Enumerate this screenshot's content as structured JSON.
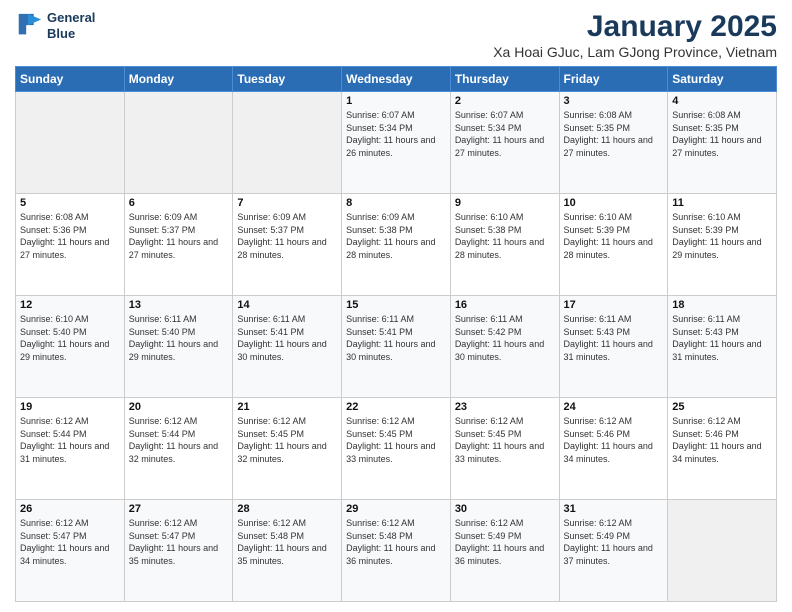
{
  "logo": {
    "line1": "General",
    "line2": "Blue"
  },
  "title": "January 2025",
  "subtitle": "Xa Hoai GJuc, Lam GJong Province, Vietnam",
  "days_of_week": [
    "Sunday",
    "Monday",
    "Tuesday",
    "Wednesday",
    "Thursday",
    "Friday",
    "Saturday"
  ],
  "weeks": [
    [
      {
        "day": "",
        "sunrise": "",
        "sunset": "",
        "daylight": "",
        "empty": true
      },
      {
        "day": "",
        "sunrise": "",
        "sunset": "",
        "daylight": "",
        "empty": true
      },
      {
        "day": "",
        "sunrise": "",
        "sunset": "",
        "daylight": "",
        "empty": true
      },
      {
        "day": "1",
        "sunrise": "Sunrise: 6:07 AM",
        "sunset": "Sunset: 5:34 PM",
        "daylight": "Daylight: 11 hours and 26 minutes."
      },
      {
        "day": "2",
        "sunrise": "Sunrise: 6:07 AM",
        "sunset": "Sunset: 5:34 PM",
        "daylight": "Daylight: 11 hours and 27 minutes."
      },
      {
        "day": "3",
        "sunrise": "Sunrise: 6:08 AM",
        "sunset": "Sunset: 5:35 PM",
        "daylight": "Daylight: 11 hours and 27 minutes."
      },
      {
        "day": "4",
        "sunrise": "Sunrise: 6:08 AM",
        "sunset": "Sunset: 5:35 PM",
        "daylight": "Daylight: 11 hours and 27 minutes."
      }
    ],
    [
      {
        "day": "5",
        "sunrise": "Sunrise: 6:08 AM",
        "sunset": "Sunset: 5:36 PM",
        "daylight": "Daylight: 11 hours and 27 minutes."
      },
      {
        "day": "6",
        "sunrise": "Sunrise: 6:09 AM",
        "sunset": "Sunset: 5:37 PM",
        "daylight": "Daylight: 11 hours and 27 minutes."
      },
      {
        "day": "7",
        "sunrise": "Sunrise: 6:09 AM",
        "sunset": "Sunset: 5:37 PM",
        "daylight": "Daylight: 11 hours and 28 minutes."
      },
      {
        "day": "8",
        "sunrise": "Sunrise: 6:09 AM",
        "sunset": "Sunset: 5:38 PM",
        "daylight": "Daylight: 11 hours and 28 minutes."
      },
      {
        "day": "9",
        "sunrise": "Sunrise: 6:10 AM",
        "sunset": "Sunset: 5:38 PM",
        "daylight": "Daylight: 11 hours and 28 minutes."
      },
      {
        "day": "10",
        "sunrise": "Sunrise: 6:10 AM",
        "sunset": "Sunset: 5:39 PM",
        "daylight": "Daylight: 11 hours and 28 minutes."
      },
      {
        "day": "11",
        "sunrise": "Sunrise: 6:10 AM",
        "sunset": "Sunset: 5:39 PM",
        "daylight": "Daylight: 11 hours and 29 minutes."
      }
    ],
    [
      {
        "day": "12",
        "sunrise": "Sunrise: 6:10 AM",
        "sunset": "Sunset: 5:40 PM",
        "daylight": "Daylight: 11 hours and 29 minutes."
      },
      {
        "day": "13",
        "sunrise": "Sunrise: 6:11 AM",
        "sunset": "Sunset: 5:40 PM",
        "daylight": "Daylight: 11 hours and 29 minutes."
      },
      {
        "day": "14",
        "sunrise": "Sunrise: 6:11 AM",
        "sunset": "Sunset: 5:41 PM",
        "daylight": "Daylight: 11 hours and 30 minutes."
      },
      {
        "day": "15",
        "sunrise": "Sunrise: 6:11 AM",
        "sunset": "Sunset: 5:41 PM",
        "daylight": "Daylight: 11 hours and 30 minutes."
      },
      {
        "day": "16",
        "sunrise": "Sunrise: 6:11 AM",
        "sunset": "Sunset: 5:42 PM",
        "daylight": "Daylight: 11 hours and 30 minutes."
      },
      {
        "day": "17",
        "sunrise": "Sunrise: 6:11 AM",
        "sunset": "Sunset: 5:43 PM",
        "daylight": "Daylight: 11 hours and 31 minutes."
      },
      {
        "day": "18",
        "sunrise": "Sunrise: 6:11 AM",
        "sunset": "Sunset: 5:43 PM",
        "daylight": "Daylight: 11 hours and 31 minutes."
      }
    ],
    [
      {
        "day": "19",
        "sunrise": "Sunrise: 6:12 AM",
        "sunset": "Sunset: 5:44 PM",
        "daylight": "Daylight: 11 hours and 31 minutes."
      },
      {
        "day": "20",
        "sunrise": "Sunrise: 6:12 AM",
        "sunset": "Sunset: 5:44 PM",
        "daylight": "Daylight: 11 hours and 32 minutes."
      },
      {
        "day": "21",
        "sunrise": "Sunrise: 6:12 AM",
        "sunset": "Sunset: 5:45 PM",
        "daylight": "Daylight: 11 hours and 32 minutes."
      },
      {
        "day": "22",
        "sunrise": "Sunrise: 6:12 AM",
        "sunset": "Sunset: 5:45 PM",
        "daylight": "Daylight: 11 hours and 33 minutes."
      },
      {
        "day": "23",
        "sunrise": "Sunrise: 6:12 AM",
        "sunset": "Sunset: 5:45 PM",
        "daylight": "Daylight: 11 hours and 33 minutes."
      },
      {
        "day": "24",
        "sunrise": "Sunrise: 6:12 AM",
        "sunset": "Sunset: 5:46 PM",
        "daylight": "Daylight: 11 hours and 34 minutes."
      },
      {
        "day": "25",
        "sunrise": "Sunrise: 6:12 AM",
        "sunset": "Sunset: 5:46 PM",
        "daylight": "Daylight: 11 hours and 34 minutes."
      }
    ],
    [
      {
        "day": "26",
        "sunrise": "Sunrise: 6:12 AM",
        "sunset": "Sunset: 5:47 PM",
        "daylight": "Daylight: 11 hours and 34 minutes."
      },
      {
        "day": "27",
        "sunrise": "Sunrise: 6:12 AM",
        "sunset": "Sunset: 5:47 PM",
        "daylight": "Daylight: 11 hours and 35 minutes."
      },
      {
        "day": "28",
        "sunrise": "Sunrise: 6:12 AM",
        "sunset": "Sunset: 5:48 PM",
        "daylight": "Daylight: 11 hours and 35 minutes."
      },
      {
        "day": "29",
        "sunrise": "Sunrise: 6:12 AM",
        "sunset": "Sunset: 5:48 PM",
        "daylight": "Daylight: 11 hours and 36 minutes."
      },
      {
        "day": "30",
        "sunrise": "Sunrise: 6:12 AM",
        "sunset": "Sunset: 5:49 PM",
        "daylight": "Daylight: 11 hours and 36 minutes."
      },
      {
        "day": "31",
        "sunrise": "Sunrise: 6:12 AM",
        "sunset": "Sunset: 5:49 PM",
        "daylight": "Daylight: 11 hours and 37 minutes."
      },
      {
        "day": "",
        "sunrise": "",
        "sunset": "",
        "daylight": "",
        "empty": true
      }
    ]
  ]
}
